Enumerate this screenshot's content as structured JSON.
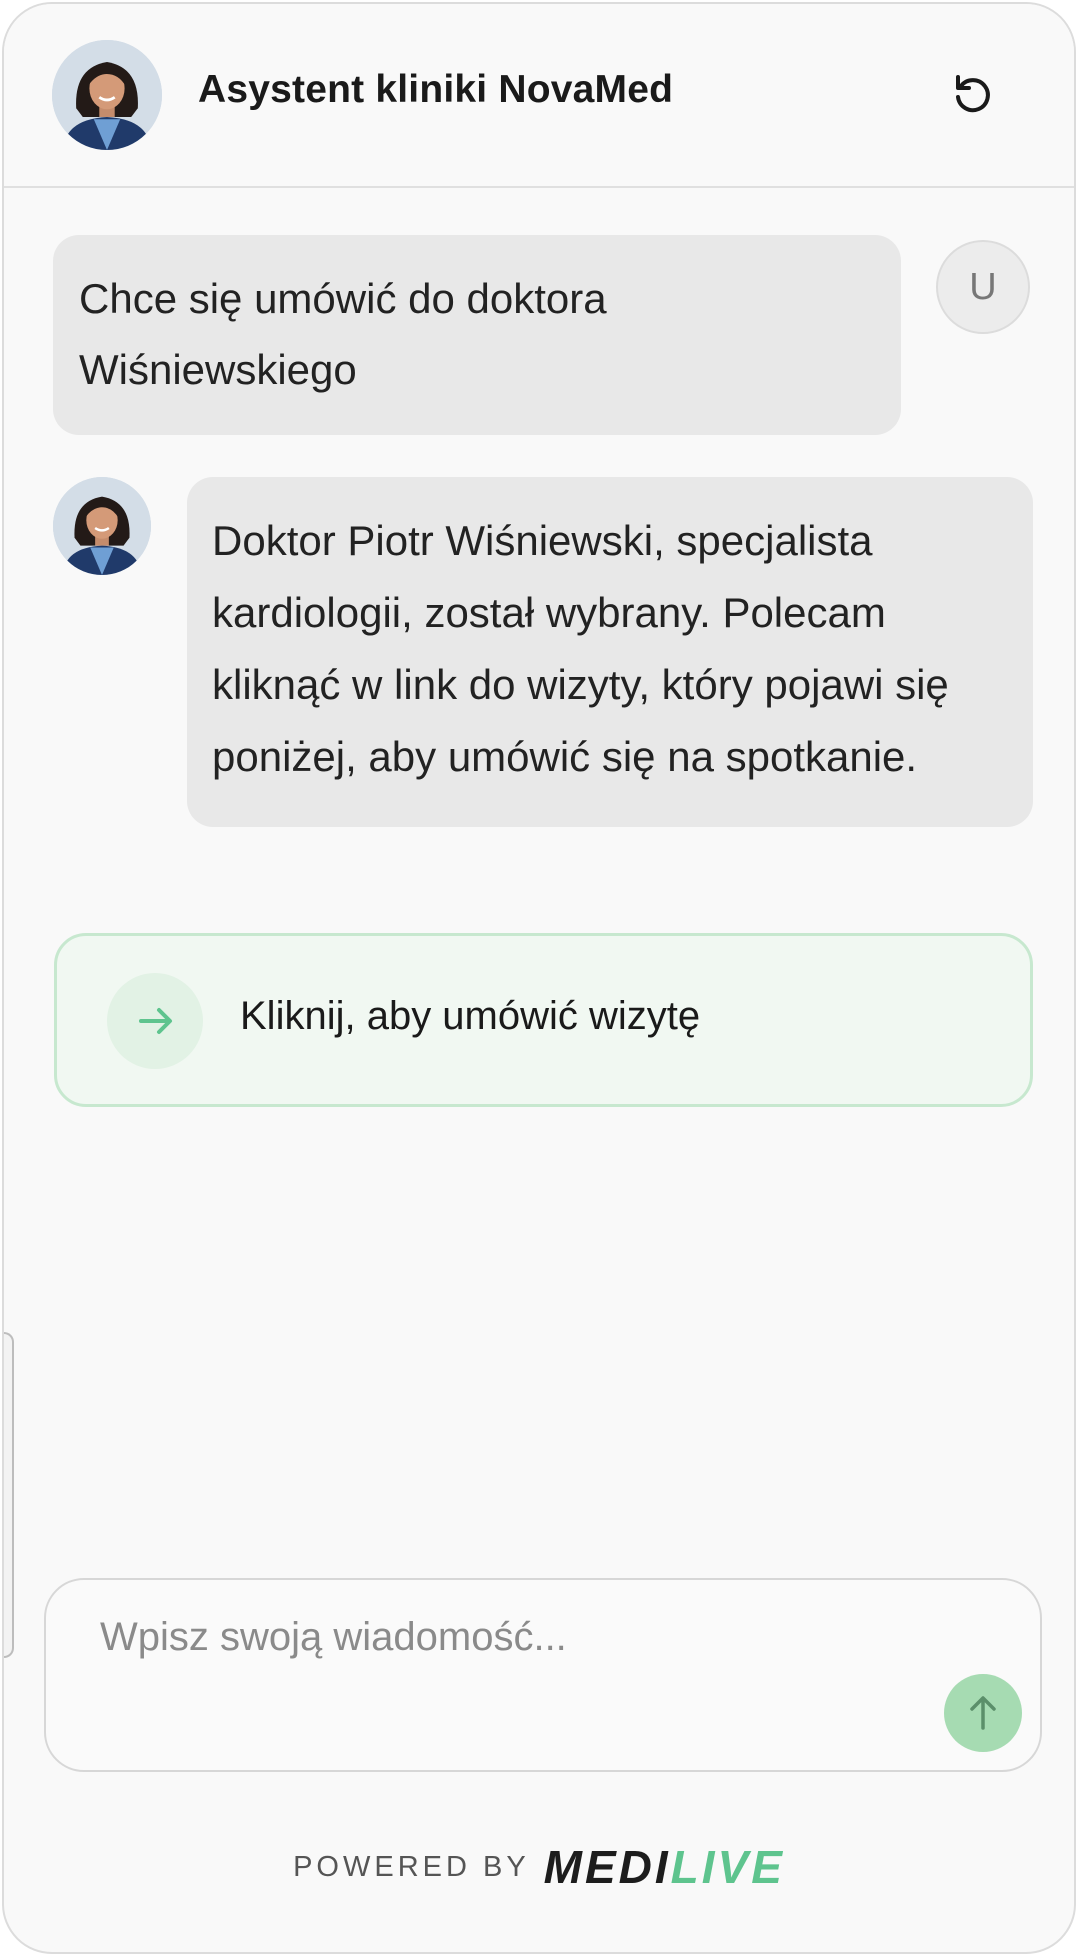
{
  "header": {
    "title": "Asystent kliniki NovaMed",
    "avatar_icon": "assistant-avatar",
    "reset_icon": "refresh-icon"
  },
  "messages": [
    {
      "role": "user",
      "avatar_initial": "U",
      "text": "Chce się umówić do doktora Wiśniewskiego"
    },
    {
      "role": "assistant",
      "avatar_icon": "assistant-avatar",
      "text": "Doktor Piotr Wiśniewski, specjalista kardiologii, został wybrany. Polecam kliknąć w link do wizyty, który pojawi się poniżej, aby umówić się na spotkanie."
    }
  ],
  "action": {
    "label": "Kliknij, aby umówić wizytę",
    "icon": "arrow-right-icon"
  },
  "input": {
    "placeholder": "Wpisz swoją wiadomość...",
    "value": "",
    "send_icon": "arrow-up-icon"
  },
  "footer": {
    "powered_by": "POWERED BY",
    "brand_part1": "MEDI",
    "brand_part2": "LIVE"
  },
  "colors": {
    "accent_green": "#5ec48e",
    "send_button": "#a6dbb2",
    "bubble": "#e8e8e8",
    "background": "#f9f9f9"
  }
}
